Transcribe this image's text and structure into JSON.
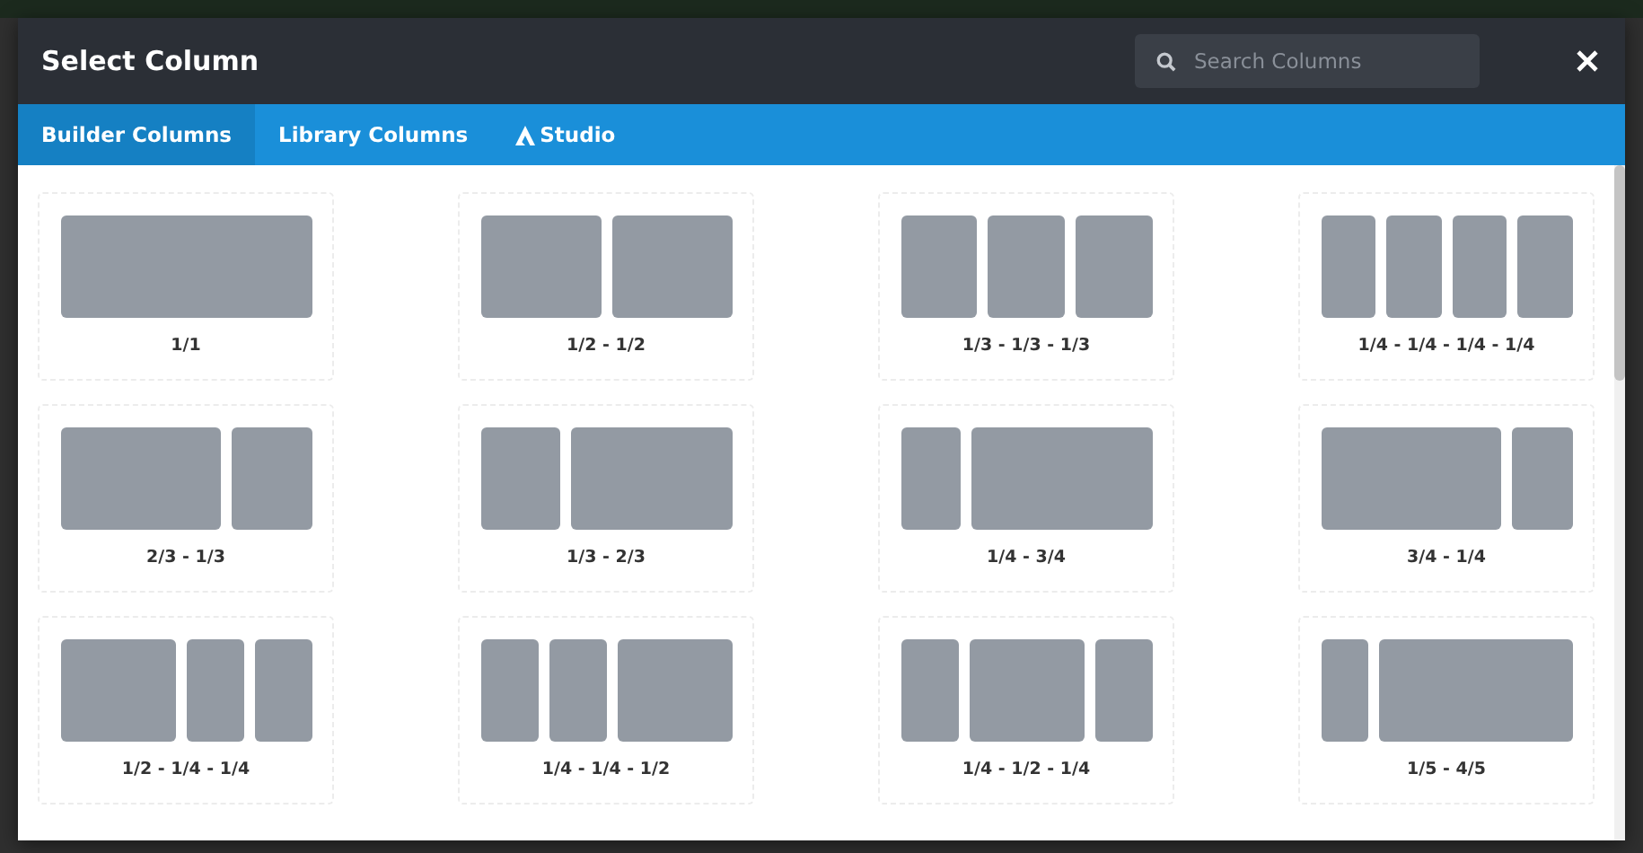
{
  "dialog": {
    "title": "Select Column",
    "search": {
      "placeholder": "Search Columns"
    }
  },
  "tabs": [
    {
      "label": "Builder Columns",
      "selected": true,
      "kind": "plain"
    },
    {
      "label": "Library Columns",
      "selected": false,
      "kind": "plain"
    },
    {
      "label": "Studio",
      "selected": false,
      "kind": "studio"
    }
  ],
  "layouts": [
    {
      "label": "1/1",
      "kind": "full"
    },
    {
      "label": "1/2 - 1/2",
      "kind": "halves"
    },
    {
      "label": "1/3 - 1/3 - 1/3",
      "kind": "thirds"
    },
    {
      "label": "1/4 - 1/4 - 1/4 - 1/4",
      "kind": "quarters"
    },
    {
      "label": "2/3 - 1/3",
      "kind": "twothirds-third"
    },
    {
      "label": "1/3 - 2/3",
      "kind": "third-twothirds"
    },
    {
      "label": "1/4 - 3/4",
      "kind": "quarter-threequarters"
    },
    {
      "label": "3/4 - 1/4",
      "kind": "threequarters-quarter"
    },
    {
      "label": "1/2 - 1/4 - 1/4",
      "kind": "half-quarter-quarter"
    },
    {
      "label": "1/4 - 1/4 - 1/2",
      "kind": "quarter-quarter-half"
    },
    {
      "label": "1/4 - 1/2 - 1/4",
      "kind": "quarter-half-quarter"
    },
    {
      "label": "1/5 - 4/5",
      "kind": "fifth-fourfifths"
    }
  ]
}
